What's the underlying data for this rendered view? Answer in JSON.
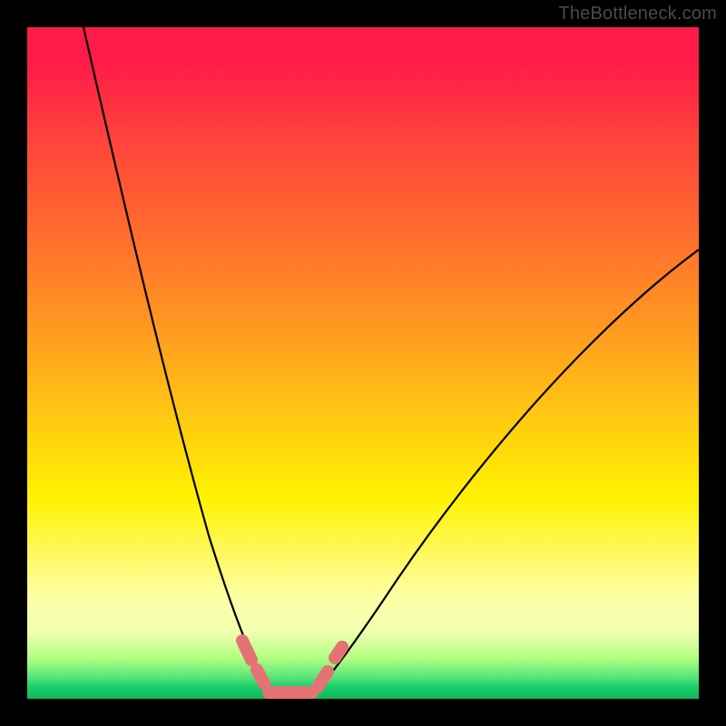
{
  "attribution": "TheBottleneck.com",
  "colors": {
    "frame": "#000000",
    "curve": "#000000",
    "marker": "#e57373",
    "gradient_top": "#ff1a49",
    "gradient_bottom": "#14b65f"
  },
  "chart_data": {
    "type": "line",
    "title": "",
    "xlabel": "",
    "ylabel": "",
    "xlim": [
      0,
      100
    ],
    "ylim": [
      0,
      100
    ],
    "grid": false,
    "legend": false,
    "note": "Axes have no tick labels; x approximates a component ratio (0–100), y approximates bottleneck percentage (0–100). Values estimated from curve shape.",
    "series": [
      {
        "name": "left-branch",
        "x": [
          8,
          12,
          16,
          20,
          24,
          28,
          30,
          32,
          34,
          36
        ],
        "y": [
          100,
          80,
          60,
          42,
          27,
          14,
          9,
          5,
          2,
          0
        ]
      },
      {
        "name": "right-branch",
        "x": [
          42,
          44,
          48,
          54,
          62,
          72,
          84,
          100
        ],
        "y": [
          0,
          3,
          8,
          17,
          28,
          41,
          54,
          67
        ]
      },
      {
        "name": "optimal-zone-markers",
        "x": [
          32,
          34,
          36,
          38,
          40,
          42,
          44
        ],
        "y": [
          4,
          1,
          0,
          0,
          0,
          0,
          3
        ]
      }
    ]
  }
}
